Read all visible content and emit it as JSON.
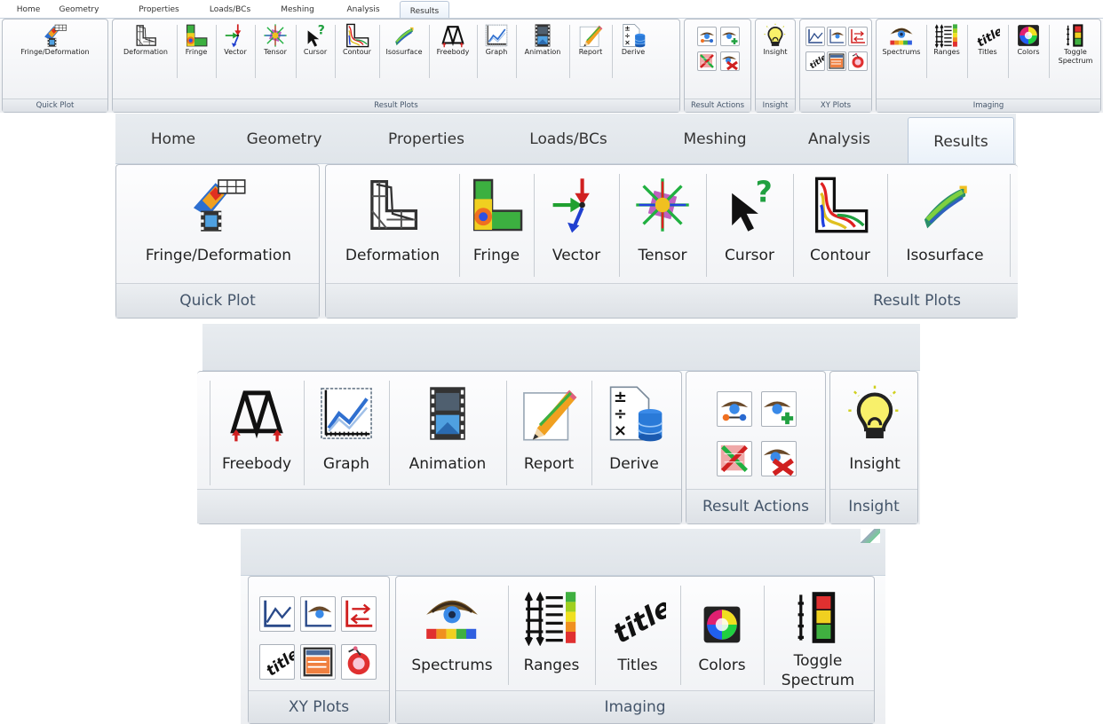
{
  "tabs": [
    "Home",
    "Geometry",
    "Properties",
    "Loads/BCs",
    "Meshing",
    "Analysis",
    "Results"
  ],
  "active_tab": "Results",
  "groups": {
    "quick_plot": "Quick Plot",
    "result_plots": "Result Plots",
    "result_actions": "Result Actions",
    "insight": "Insight",
    "xy_plots": "XY Plots",
    "imaging": "Imaging"
  },
  "buttons": {
    "fringe_deformation": "Fringe/Deformation",
    "deformation": "Deformation",
    "fringe": "Fringe",
    "vector": "Vector",
    "tensor": "Tensor",
    "cursor": "Cursor",
    "contour": "Contour",
    "isosurface": "Isosurface",
    "freebody": "Freebody",
    "graph": "Graph",
    "animation": "Animation",
    "report": "Report",
    "derive": "Derive",
    "insight": "Insight",
    "spectrums": "Spectrums",
    "ranges": "Ranges",
    "titles": "Titles",
    "colors": "Colors",
    "toggle_1": "Toggle",
    "toggle_2": "Spectrum"
  },
  "icons": {
    "title_glyph": "title",
    "cursor_glyph": "?"
  },
  "colors": {
    "tab_active_border": "#b9c7d8",
    "group_border": "#b8bfc8",
    "footer_text": "#44556a"
  }
}
